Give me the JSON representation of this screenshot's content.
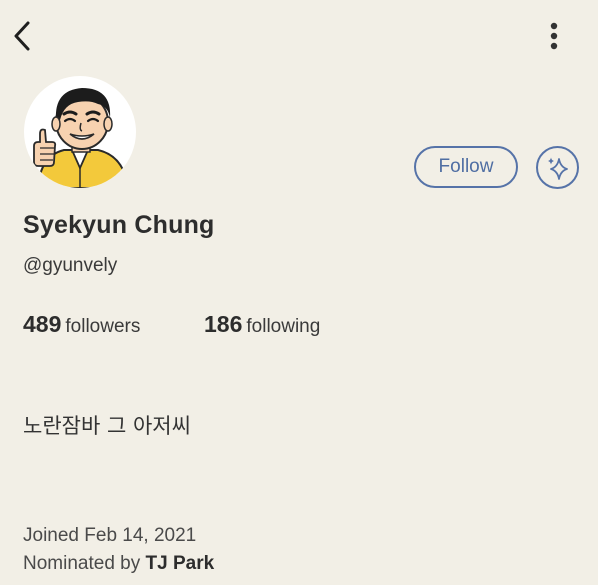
{
  "header": {
    "back_icon": "chevron-left-icon",
    "more_icon": "vertical-dots-icon"
  },
  "profile": {
    "name": "Syekyun Chung",
    "handle": "@gyunvely",
    "avatar": "cartoon-man-thumbs-up-illustration",
    "bio": "노란잠바 그 아저씨",
    "joined": "Joined Feb 14, 2021",
    "nominated_prefix": "Nominated by",
    "nominator": "TJ Park"
  },
  "stats": {
    "followers_count": "489",
    "followers_label": "followers",
    "following_count": "186",
    "following_label": "following"
  },
  "actions": {
    "follow_label": "Follow",
    "sparkle_icon": "sparkle-icon"
  },
  "colors": {
    "background": "#f2efe6",
    "accent": "#5673a8",
    "text": "#2d2d2d",
    "jacket": "#f3c93b"
  }
}
